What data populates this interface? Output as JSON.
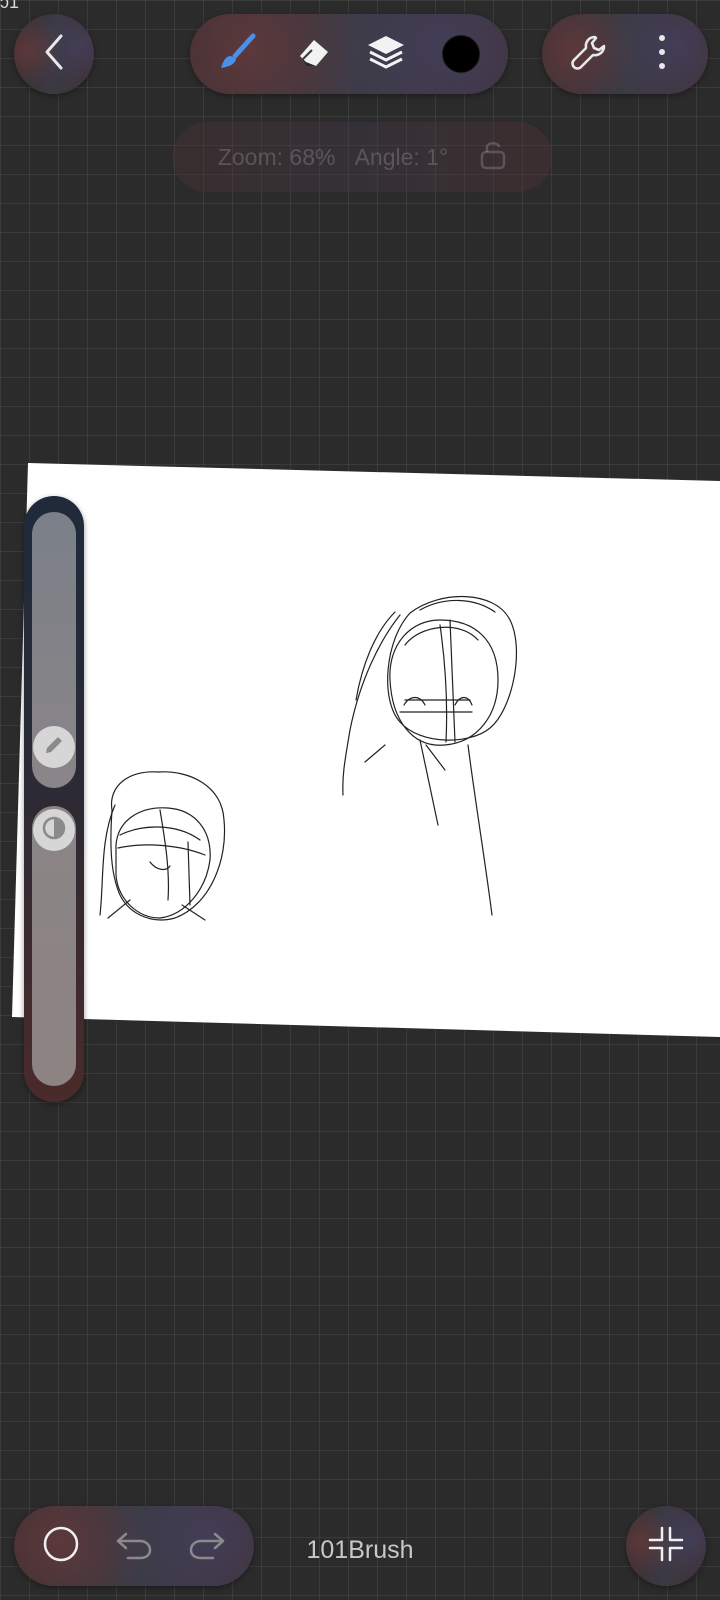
{
  "status_bar": {
    "fragment": "ͻ1"
  },
  "toolbar": {
    "back_icon": "chevron-left-icon",
    "tools": [
      {
        "name": "brush",
        "icon": "brush-icon",
        "active": true,
        "color": "#4a8fe8"
      },
      {
        "name": "eraser",
        "icon": "eraser-icon"
      },
      {
        "name": "layers",
        "icon": "layers-icon"
      },
      {
        "name": "color",
        "icon": "color-swatch",
        "color": "#000000"
      }
    ],
    "settings_icon": "wrench-icon",
    "more_icon": "more-vertical-icon"
  },
  "hud": {
    "zoom_text": "Zoom: 68%",
    "angle_text": "Angle: 1°",
    "lock_icon": "lock-open-icon"
  },
  "side_slider": {
    "size_icon": "pencil-icon",
    "opacity_icon": "half-circle-icon"
  },
  "bottom_bar": {
    "shape_icon": "circle-icon",
    "undo_icon": "undo-icon",
    "redo_icon": "redo-icon",
    "brush_name": "101Brush",
    "fullscreen_icon": "collapse-icon"
  }
}
